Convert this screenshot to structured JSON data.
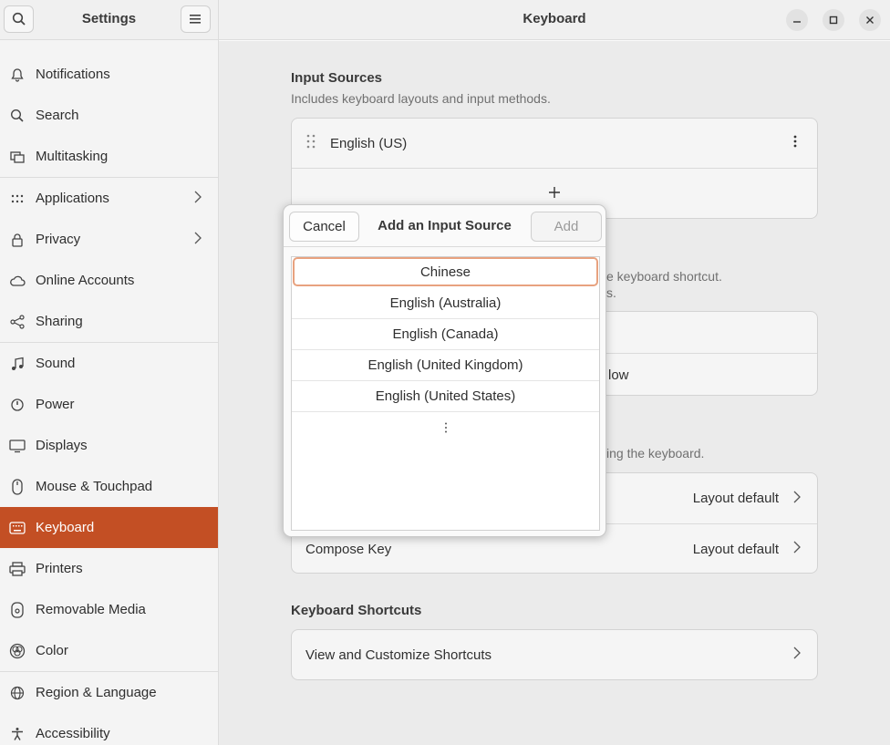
{
  "sidebar": {
    "title": "Settings",
    "items": [
      {
        "label": "Notifications",
        "icon": "bell-icon"
      },
      {
        "label": "Search",
        "icon": "search-icon"
      },
      {
        "label": "Multitasking",
        "icon": "multitasking-icon"
      },
      {
        "label": "Applications",
        "icon": "apps-grid-icon"
      },
      {
        "label": "Privacy",
        "icon": "lock-icon"
      },
      {
        "label": "Online Accounts",
        "icon": "cloud-icon"
      },
      {
        "label": "Sharing",
        "icon": "share-icon"
      },
      {
        "label": "Sound",
        "icon": "music-note-icon"
      },
      {
        "label": "Power",
        "icon": "power-icon"
      },
      {
        "label": "Displays",
        "icon": "display-icon"
      },
      {
        "label": "Mouse & Touchpad",
        "icon": "mouse-icon"
      },
      {
        "label": "Keyboard",
        "icon": "keyboard-icon"
      },
      {
        "label": "Printers",
        "icon": "printer-icon"
      },
      {
        "label": "Removable Media",
        "icon": "disc-icon"
      },
      {
        "label": "Color",
        "icon": "color-icon"
      },
      {
        "label": "Region & Language",
        "icon": "globe-icon"
      },
      {
        "label": "Accessibility",
        "icon": "accessibility-icon"
      }
    ]
  },
  "header": {
    "title": "Keyboard"
  },
  "input_sources": {
    "title": "Input Sources",
    "subtitle": "Includes keyboard layouts and input methods.",
    "items": [
      "English (US)"
    ],
    "add_icon": "plus-icon"
  },
  "obscured": {
    "switch_hint": "e keyboard shortcut.",
    "switch_hint2": "s.",
    "window_option": "low",
    "special_hint": "ing the keyboard."
  },
  "special_chars": {
    "alternate_value": "Layout default",
    "compose_label": "Compose Key",
    "compose_value": "Layout default"
  },
  "shortcuts": {
    "title": "Keyboard Shortcuts",
    "row_label": "View and Customize Shortcuts"
  },
  "dialog": {
    "title": "Add an Input Source",
    "cancel_label": "Cancel",
    "add_label": "Add",
    "languages": [
      "Chinese",
      "English (Australia)",
      "English (Canada)",
      "English (United Kingdom)",
      "English (United States)"
    ],
    "more_icon": "vertical-ellipsis-icon"
  },
  "colors": {
    "accent": "#c34f24",
    "selection_border": "#e8a27f"
  }
}
